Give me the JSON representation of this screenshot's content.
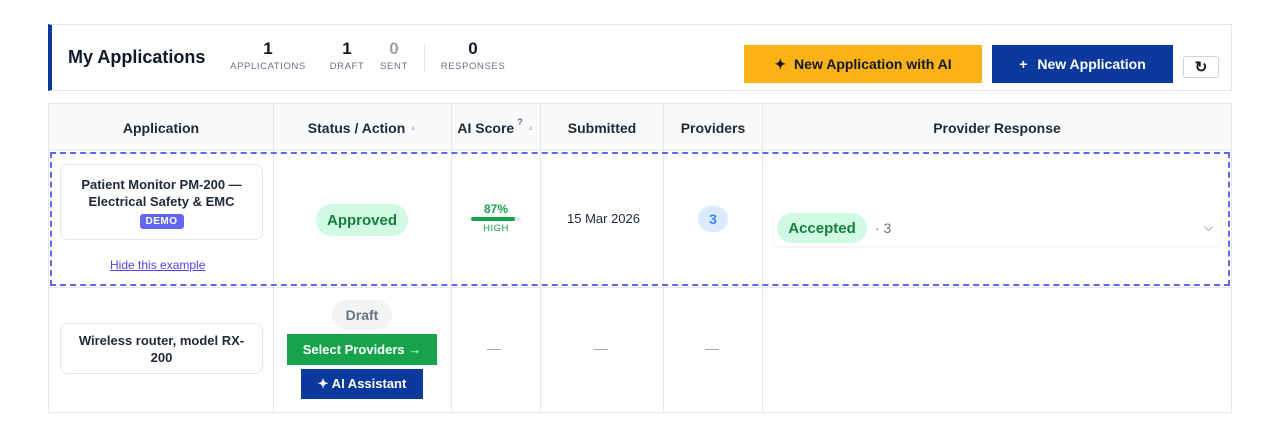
{
  "header": {
    "title": "My Applications",
    "stats": [
      {
        "value": "1",
        "label": "APPLICATIONS"
      },
      {
        "value": "1",
        "label": "DRAFT"
      },
      {
        "value": "0",
        "label": "SENT"
      },
      {
        "value": "0",
        "label": "RESPONSES"
      }
    ],
    "ai_button": {
      "icon": "✦",
      "label": "New Application with AI"
    },
    "new_button": {
      "icon": "+",
      "label": "New Application"
    },
    "refresh_icon": "↻"
  },
  "table": {
    "columns": [
      "Application",
      "Status / Action",
      "AI Score",
      "Submitted",
      "Providers",
      "Provider Response"
    ],
    "score_help": "?",
    "rows": [
      {
        "application": "Patient Monitor PM-200 — Electrical Safety & EMC",
        "badge": "DEMO",
        "hide_link": "Hide this example",
        "status": "Approved",
        "ai_score": "87%",
        "ai_score_fraction": 0.87,
        "ai_level": "HIGH",
        "submitted": "15 Mar 2026",
        "providers": "3",
        "response_status": "Accepted",
        "response_count": "· 3"
      },
      {
        "application": "Wireless router, model RX-200",
        "status": "Draft",
        "select_button": "Select Providers →",
        "assistant_button": "✦ AI Assistant",
        "ai_score": "—",
        "submitted": "—",
        "providers": "—"
      }
    ]
  },
  "colors": {
    "brand_blue": "#0b3a9c",
    "accent_yellow": "#fbb216",
    "success_green": "#16a34a",
    "demo_purple": "#6366f1"
  }
}
